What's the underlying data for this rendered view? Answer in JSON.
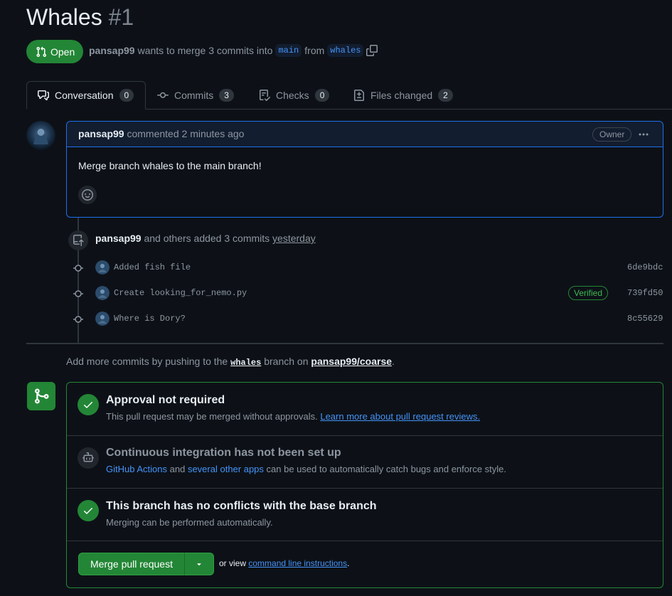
{
  "pr": {
    "title": "Whales",
    "number": "#1",
    "state": "Open",
    "author": "pansap99",
    "merge_text_pre": "wants to merge 3 commits into",
    "base_branch": "main",
    "from_text": "from",
    "head_branch": "whales"
  },
  "tabs": [
    {
      "label": "Conversation",
      "count": "0",
      "icon": "comment-discussion-icon"
    },
    {
      "label": "Commits",
      "count": "3",
      "icon": "git-commit-icon"
    },
    {
      "label": "Checks",
      "count": "0",
      "icon": "checklist-icon"
    },
    {
      "label": "Files changed",
      "count": "2",
      "icon": "file-diff-icon"
    }
  ],
  "comment": {
    "author": "pansap99",
    "action": "commented 2 minutes ago",
    "badge": "Owner",
    "body": "Merge branch whales to the main branch!"
  },
  "push_event": {
    "author": "pansap99",
    "text": "and others added 3 commits",
    "when": "yesterday"
  },
  "commits": [
    {
      "message": "Added fish file",
      "sha": "6de9bdc",
      "verified": ""
    },
    {
      "message": "Create looking_for_nemo.py",
      "sha": "739fd50",
      "verified": "Verified"
    },
    {
      "message": "Where is Dory?",
      "sha": "8c55629",
      "verified": ""
    }
  ],
  "push_more": {
    "pre": "Add more commits by pushing to the",
    "branch": "whales",
    "mid": "branch on",
    "repo": "pansap99/coarse",
    "end": "."
  },
  "merge_box": {
    "approval_title": "Approval not required",
    "approval_desc": "This pull request may be merged without approvals.",
    "approval_link": "Learn more about pull request reviews.",
    "ci_title": "Continuous integration has not been set up",
    "ci_link1": "GitHub Actions",
    "ci_and": "and",
    "ci_link2": "several other apps",
    "ci_desc": "can be used to automatically catch bugs and enforce style.",
    "conflict_title": "This branch has no conflicts with the base branch",
    "conflict_desc": "Merging can be performed automatically.",
    "merge_button": "Merge pull request",
    "or_view": "or view",
    "cli_link": "command line instructions",
    "cli_end": "."
  },
  "colors": {
    "bg": "#0d1117",
    "green": "#238636",
    "blue_accent": "#1f6feb",
    "link": "#4493f8",
    "muted": "#8d96a0"
  }
}
